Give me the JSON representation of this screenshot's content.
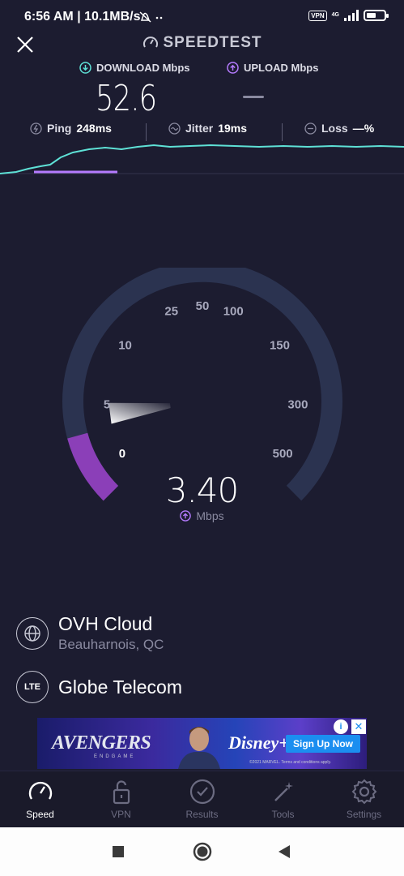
{
  "status_bar": {
    "time": "6:56 AM | 10.1MB/s",
    "vpn": "VPN",
    "network": "4G",
    "battery_level": 0.55
  },
  "header": {
    "title": "SPEEDTEST",
    "download_label": "DOWNLOAD Mbps",
    "upload_label": "UPLOAD Mbps",
    "download_value": "52.6",
    "upload_value": "—"
  },
  "metrics": {
    "ping_label": "Ping",
    "ping_value": "248ms",
    "jitter_label": "Jitter",
    "jitter_value": "19ms",
    "loss_label": "Loss",
    "loss_value": "—%"
  },
  "gauge": {
    "ticks": [
      "0",
      "5",
      "10",
      "25",
      "50",
      "100",
      "150",
      "300",
      "500"
    ],
    "current_value": "3.40",
    "unit": "Mbps",
    "current_fraction": 0.11
  },
  "server": {
    "name": "OVH Cloud",
    "location": "Beauharnois, QC"
  },
  "carrier": {
    "badge": "LTE",
    "name": "Globe Telecom"
  },
  "ad": {
    "title": "AVENGERS",
    "subtitle": "ENDGAME",
    "brand": "Disney+",
    "cta": "Sign Up Now",
    "legal": "©2021 MARVEL. Terms and conditions apply."
  },
  "tabs": [
    {
      "label": "Speed",
      "icon": "speedometer-icon",
      "active": true
    },
    {
      "label": "VPN",
      "icon": "lock-icon",
      "active": false
    },
    {
      "label": "Results",
      "icon": "check-circle-icon",
      "active": false
    },
    {
      "label": "Tools",
      "icon": "magic-wand-icon",
      "active": false
    },
    {
      "label": "Settings",
      "icon": "gear-icon",
      "active": false
    }
  ],
  "colors": {
    "background": "#1c1c30",
    "accent_download": "#5ee1d6",
    "accent_upload": "#b57bff",
    "gauge_fill": "#8b3fb8"
  }
}
